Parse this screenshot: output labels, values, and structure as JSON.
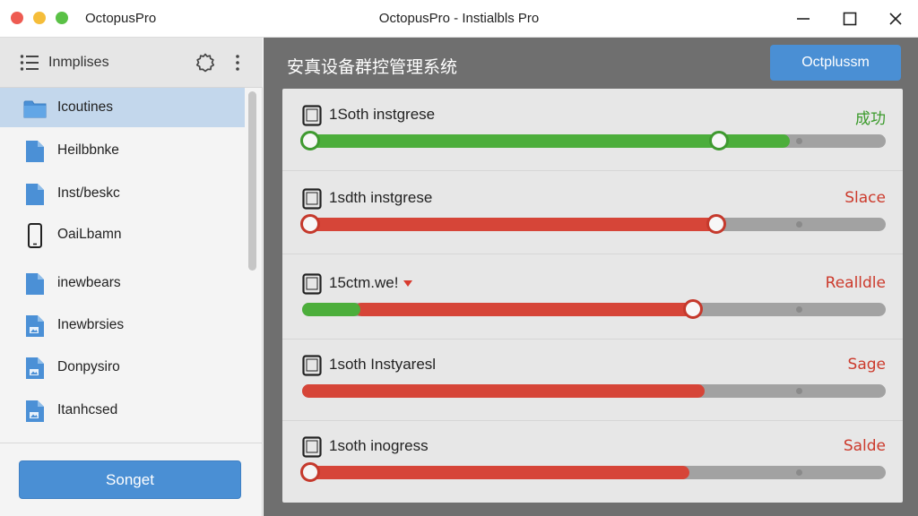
{
  "window": {
    "app_name": "OctopusPro",
    "title": "OctopusPro - Instialbls Pro",
    "minimize_symbol": "—",
    "maximize_symbol": "☐",
    "close_symbol": "✕"
  },
  "sidebar": {
    "header_label": "Inmplises",
    "items": [
      {
        "label": "Icoutines",
        "icon": "folder-icon",
        "selected": true
      },
      {
        "label": "Heilbbnke",
        "icon": "document-icon",
        "selected": false
      },
      {
        "label": "Inst/beskc",
        "icon": "document-icon",
        "selected": false
      },
      {
        "label": "OaiLbamn",
        "icon": "phone-icon",
        "selected": false
      },
      {
        "label": "inewbears",
        "icon": "document-icon",
        "selected": false
      },
      {
        "label": "Inewbrsies",
        "icon": "document-image-icon",
        "selected": false
      },
      {
        "label": "Donpysiro",
        "icon": "document-image-icon",
        "selected": false
      },
      {
        "label": "Itanhcsed",
        "icon": "document-image-icon",
        "selected": false
      }
    ],
    "button_label": "Songet"
  },
  "main": {
    "title": "安真设备群控管理系统",
    "button_label": "Octplussm",
    "devices": [
      {
        "name": "1Soth instgrese",
        "status": "成功",
        "status_color": "#3a9a2a",
        "fill_color": "#4cae3b",
        "progress": 0.835,
        "knob": 0.715,
        "knob_color": "#3f9a30",
        "start_knob": true,
        "secondary_fill": null,
        "dropdown": false
      },
      {
        "name": "1sdth instgrese",
        "status": "Slace",
        "status_color": "#cc3a2c",
        "fill_color": "#d64538",
        "progress": 0.71,
        "knob": 0.71,
        "knob_color": "#c5392c",
        "start_knob": true,
        "secondary_fill": null,
        "dropdown": false
      },
      {
        "name": "15ctm.we!",
        "status": "Realldle",
        "status_color": "#cc3a2c",
        "fill_color": "#4cae3b",
        "progress": 0.1,
        "knob": 0.67,
        "knob_color": "#c5392c",
        "start_knob": false,
        "secondary_fill": {
          "from": 0.09,
          "to": 0.675,
          "color": "#d64538"
        },
        "dropdown": true
      },
      {
        "name": "1soth Instyaresl",
        "status": "Sage",
        "status_color": "#cc3a2c",
        "fill_color": "#d64538",
        "progress": 0.69,
        "knob": null,
        "knob_color": "#c5392c",
        "start_knob": false,
        "secondary_fill": null,
        "dropdown": false
      },
      {
        "name": "1soth inogress",
        "status": "Salde",
        "status_color": "#cc3a2c",
        "fill_color": "#d64538",
        "progress": 0.663,
        "knob": null,
        "knob_color": "#c5392c",
        "start_knob": true,
        "start_knob_hollow": true,
        "secondary_fill": null,
        "dropdown": false
      }
    ]
  }
}
